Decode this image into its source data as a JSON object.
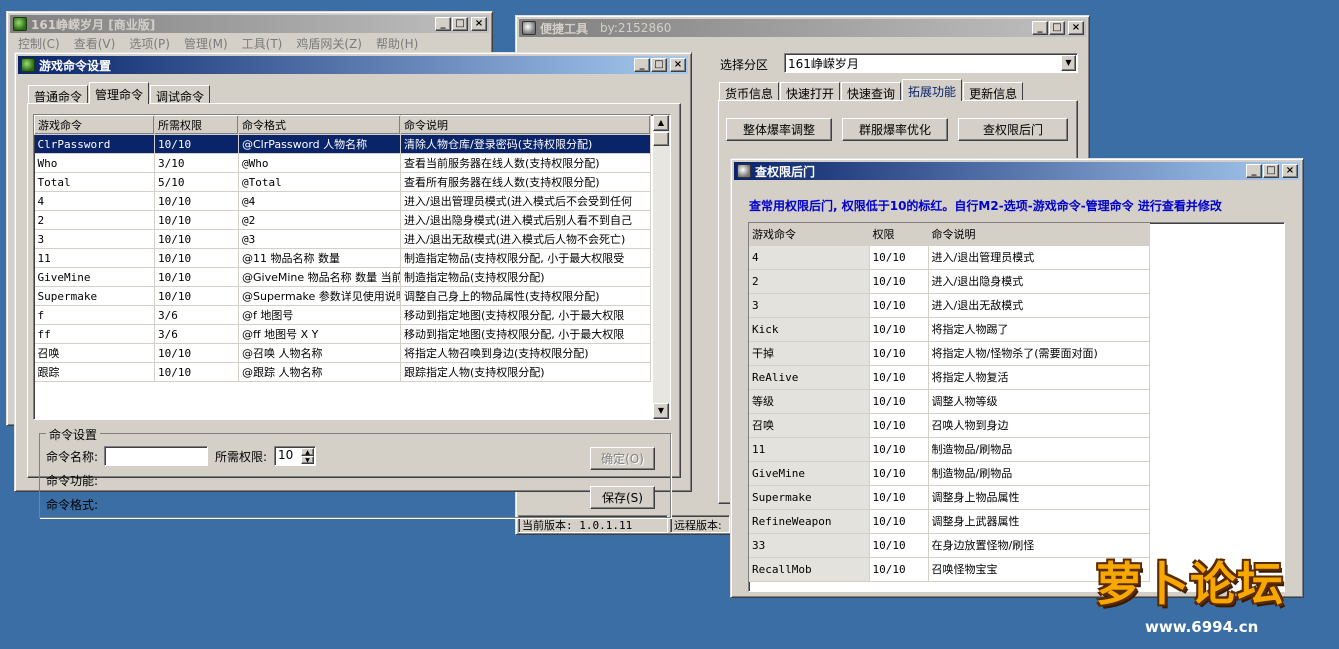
{
  "main_window": {
    "title": "161峥嵘岁月 [商业版]",
    "menu": [
      "控制(C)",
      "查看(V)",
      "选项(P)",
      "管理(M)",
      "工具(T)",
      "鸡盾网关(Z)",
      "帮助(H)"
    ]
  },
  "cmd_window": {
    "title": "游戏命令设置",
    "tabs": [
      "普通命令",
      "管理命令",
      "调试命令"
    ],
    "selected_tab": "管理命令",
    "columns": [
      "游戏命令",
      "所需权限",
      "命令格式",
      "命令说明"
    ],
    "rows": [
      [
        "ClrPassword",
        "10/10",
        "@ClrPassword 人物名称",
        "清除人物仓库/登录密码(支持权限分配)"
      ],
      [
        "Who",
        "3/10",
        "@Who",
        "查看当前服务器在线人数(支持权限分配)"
      ],
      [
        "Total",
        "5/10",
        "@Total",
        "查看所有服务器在线人数(支持权限分配)"
      ],
      [
        "4",
        "10/10",
        "@4",
        "进入/退出管理员模式(进入模式后不会受到任何"
      ],
      [
        "2",
        "10/10",
        "@2",
        "进入/退出隐身模式(进入模式后别人看不到自己"
      ],
      [
        "3",
        "10/10",
        "@3",
        "进入/退出无敌模式(进入模式后人物不会死亡)"
      ],
      [
        "11",
        "10/10",
        "@11 物品名称 数量",
        "制造指定物品(支持权限分配, 小于最大权限受"
      ],
      [
        "GiveMine",
        "10/10",
        "@GiveMine 物品名称 数量 当前",
        "制造指定物品(支持权限分配)"
      ],
      [
        "Supermake",
        "10/10",
        "@Supermake 参数详见使用说明",
        "调整自己身上的物品属性(支持权限分配)"
      ],
      [
        "f",
        "3/6",
        "@f 地图号",
        "移动到指定地图(支持权限分配, 小于最大权限"
      ],
      [
        "ff",
        "3/6",
        "@ff 地图号 X Y",
        "移动到指定地图(支持权限分配, 小于最大权限"
      ],
      [
        "召唤",
        "10/10",
        "@召唤 人物名称",
        "将指定人物召唤到身边(支持权限分配)"
      ],
      [
        "跟踪",
        "10/10",
        "@跟踪 人物名称",
        "跟踪指定人物(支持权限分配)"
      ]
    ],
    "group_title": "命令设置",
    "name_label": "命令名称:",
    "name_value": "",
    "perm_label": "所需权限:",
    "perm_value": "10",
    "func_label": "命令功能:",
    "format_label": "命令格式:",
    "ok_button": "确定(O)",
    "save_button": "保存(S)"
  },
  "tool_window": {
    "title": "便捷工具",
    "author": "by:2152860",
    "zone_label": "选择分区",
    "zone_value": "161峥嵘岁月",
    "tabs": [
      "货币信息",
      "快速打开",
      "快速查询",
      "拓展功能",
      "更新信息"
    ],
    "selected_tab": "拓展功能",
    "buttons": [
      "整体爆率调整",
      "群服爆率优化",
      "查权限后门"
    ],
    "status_current": "当前版本: 1.0.1.11",
    "status_remote": "远程版本:"
  },
  "backdoor_window": {
    "title": "查权限后门",
    "notice": "查常用权限后门, 权限低于10的标红。自行M2-选项-游戏命令-管理命令 进行查看并修改",
    "columns": [
      "游戏命令",
      "权限",
      "命令说明"
    ],
    "rows": [
      [
        "4",
        "10/10",
        "进入/退出管理员模式"
      ],
      [
        "2",
        "10/10",
        "进入/退出隐身模式"
      ],
      [
        "3",
        "10/10",
        "进入/退出无敌模式"
      ],
      [
        "Kick",
        "10/10",
        "将指定人物踢了"
      ],
      [
        "干掉",
        "10/10",
        "将指定人物/怪物杀了(需要面对面)"
      ],
      [
        "ReAlive",
        "10/10",
        "将指定人物复活"
      ],
      [
        "等级",
        "10/10",
        "调整人物等级"
      ],
      [
        "召唤",
        "10/10",
        "召唤人物到身边"
      ],
      [
        "11",
        "10/10",
        "制造物品/刷物品"
      ],
      [
        "GiveMine",
        "10/10",
        "制造物品/刷物品"
      ],
      [
        "Supermake",
        "10/10",
        "调整身上物品属性"
      ],
      [
        "RefineWeapon",
        "10/10",
        "调整身上武器属性"
      ],
      [
        "33",
        "10/10",
        "在身边放置怪物/刷怪"
      ],
      [
        "RecallMob",
        "10/10",
        "召唤怪物宝宝"
      ]
    ]
  },
  "watermark": {
    "text": "萝卜论坛",
    "url": "www.6994.cn"
  },
  "colors": {
    "desktop": "#3a6ea5",
    "title_active": "#0a246a",
    "selection": "#0a246a",
    "notice_text": "#0000cc"
  }
}
